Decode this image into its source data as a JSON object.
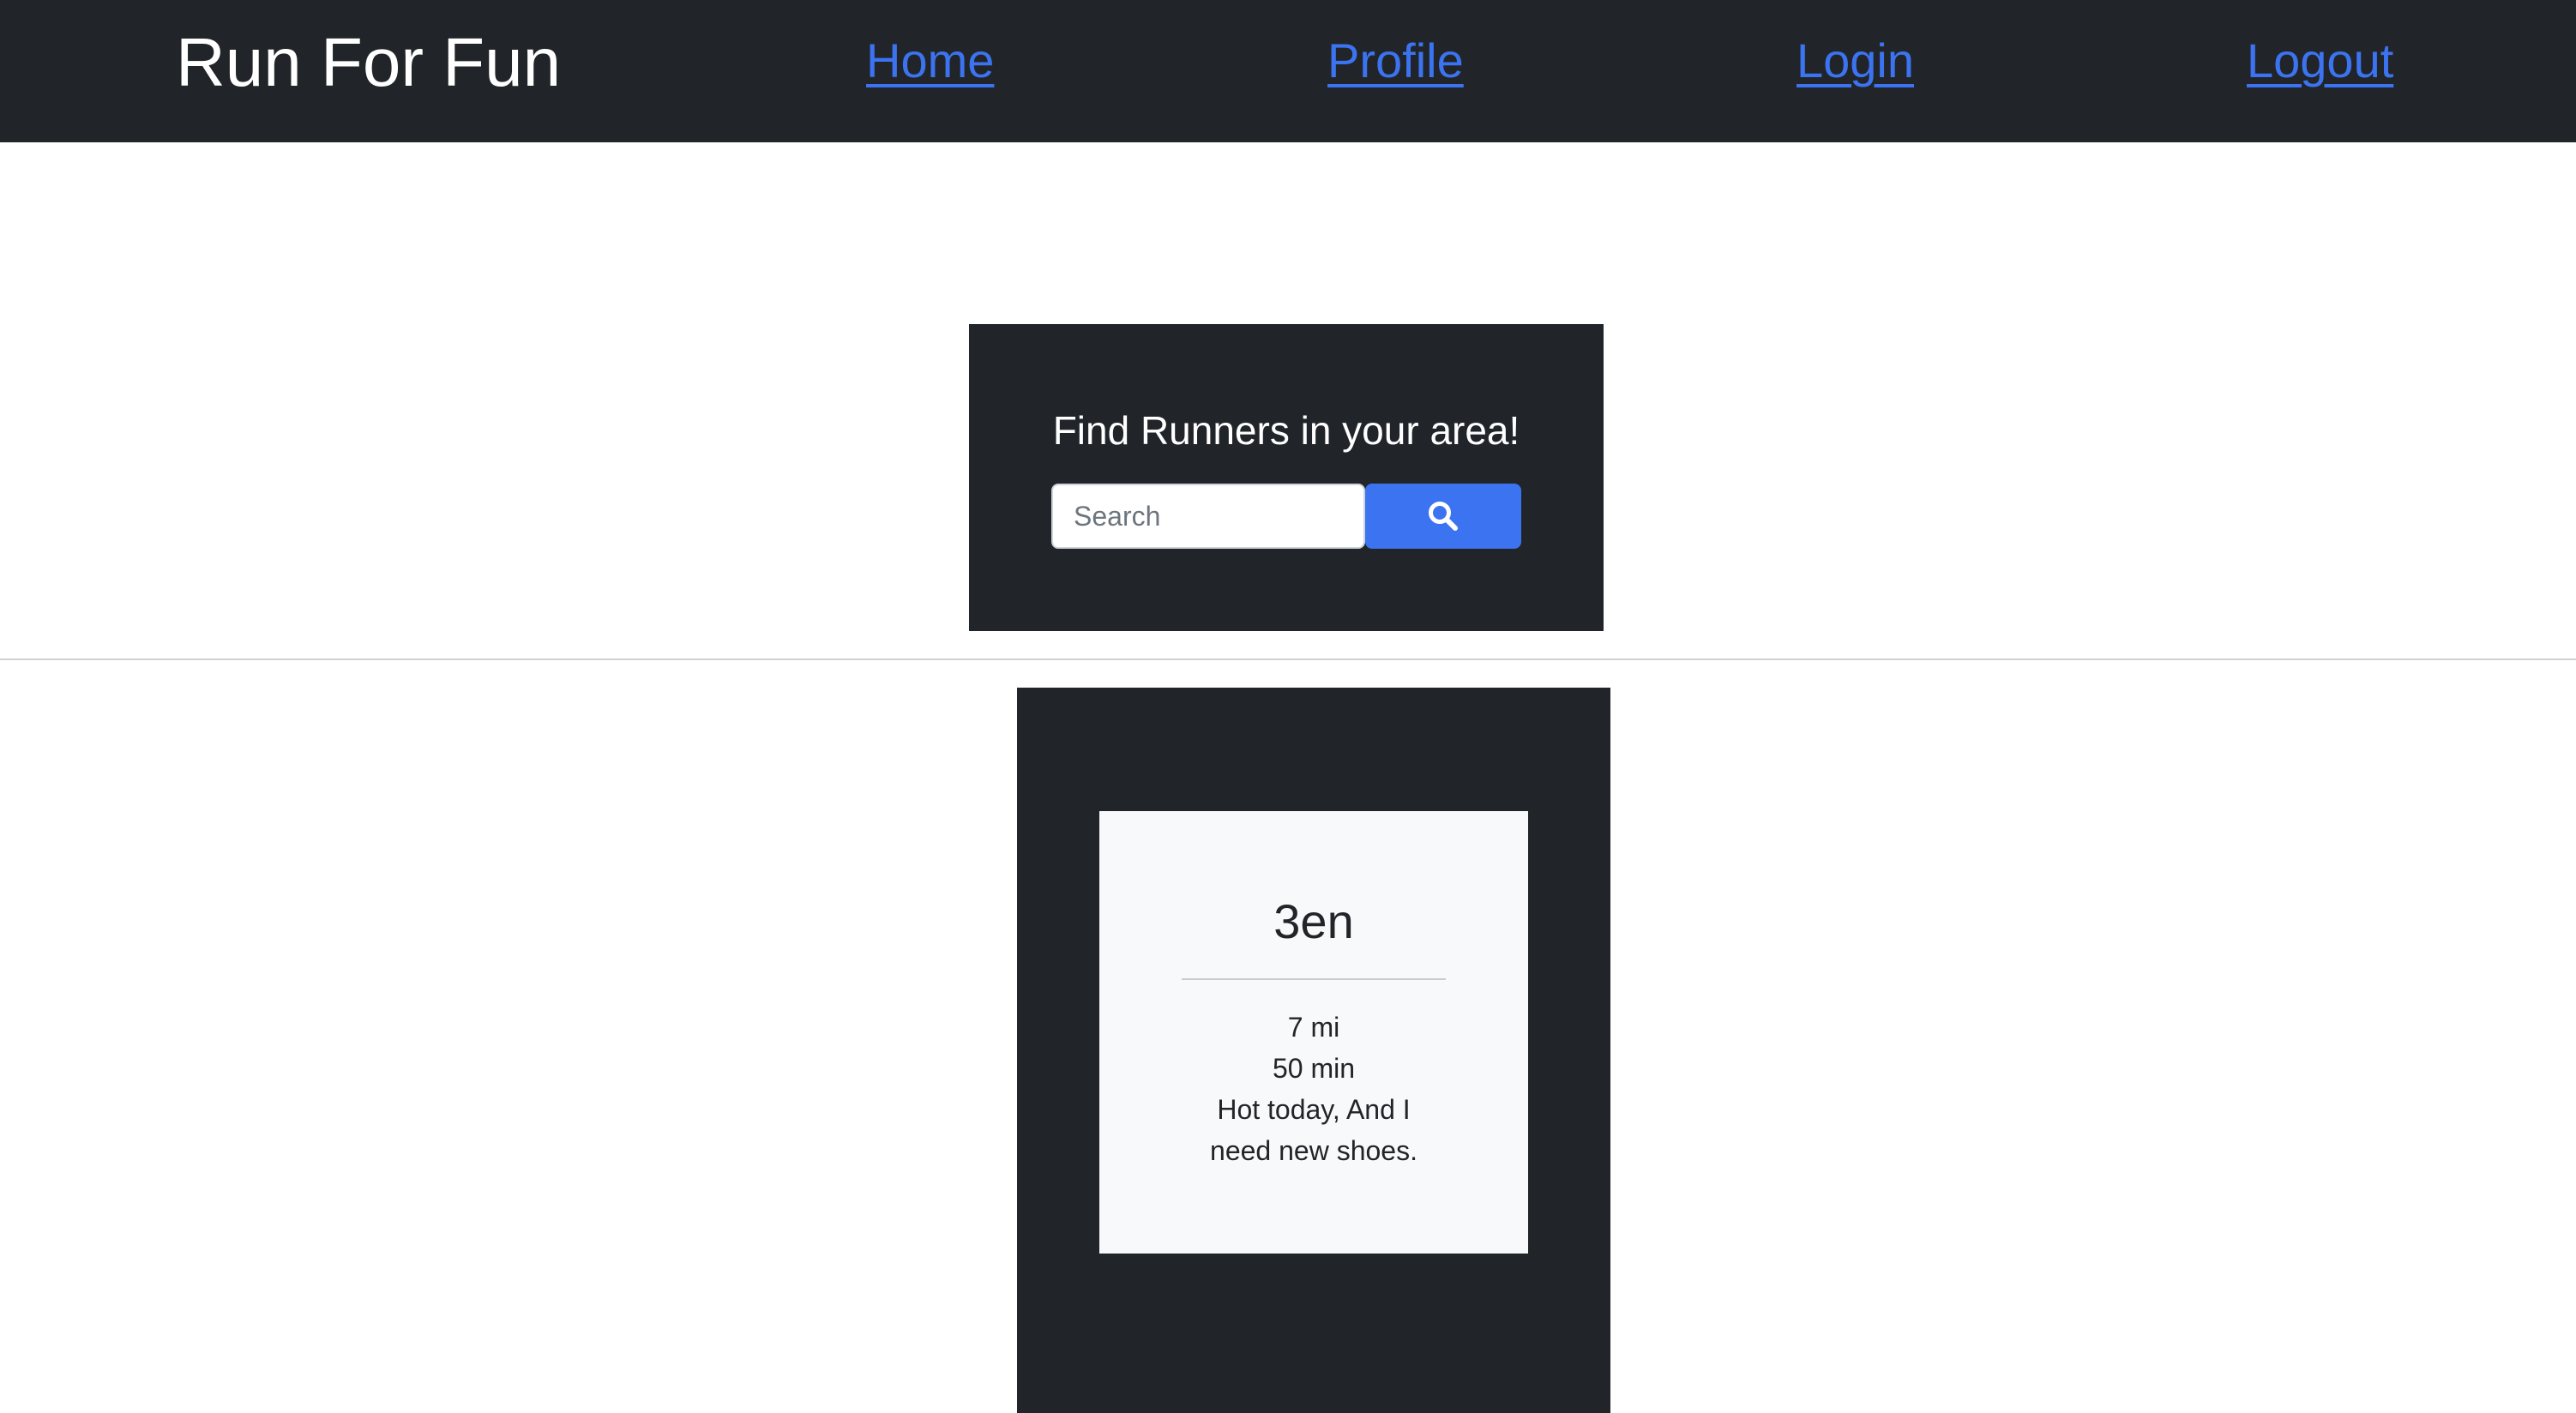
{
  "app": {
    "brand": "Run For Fun"
  },
  "nav": {
    "home": "Home",
    "profile": "Profile",
    "login": "Login",
    "logout": "Logout",
    "link_color": "#3b73f0"
  },
  "search": {
    "title": "Find Runners in your area!",
    "placeholder": "Search",
    "value": "",
    "button_icon": "search-icon",
    "button_color": "#3b73f0"
  },
  "feed": {
    "runs": [
      {
        "name": "3en",
        "distance": "7 mi",
        "duration": "50 min",
        "note": "Hot today, And I need new shoes."
      }
    ]
  },
  "theme": {
    "dark": "#212529",
    "card": "#f8f9fa"
  }
}
